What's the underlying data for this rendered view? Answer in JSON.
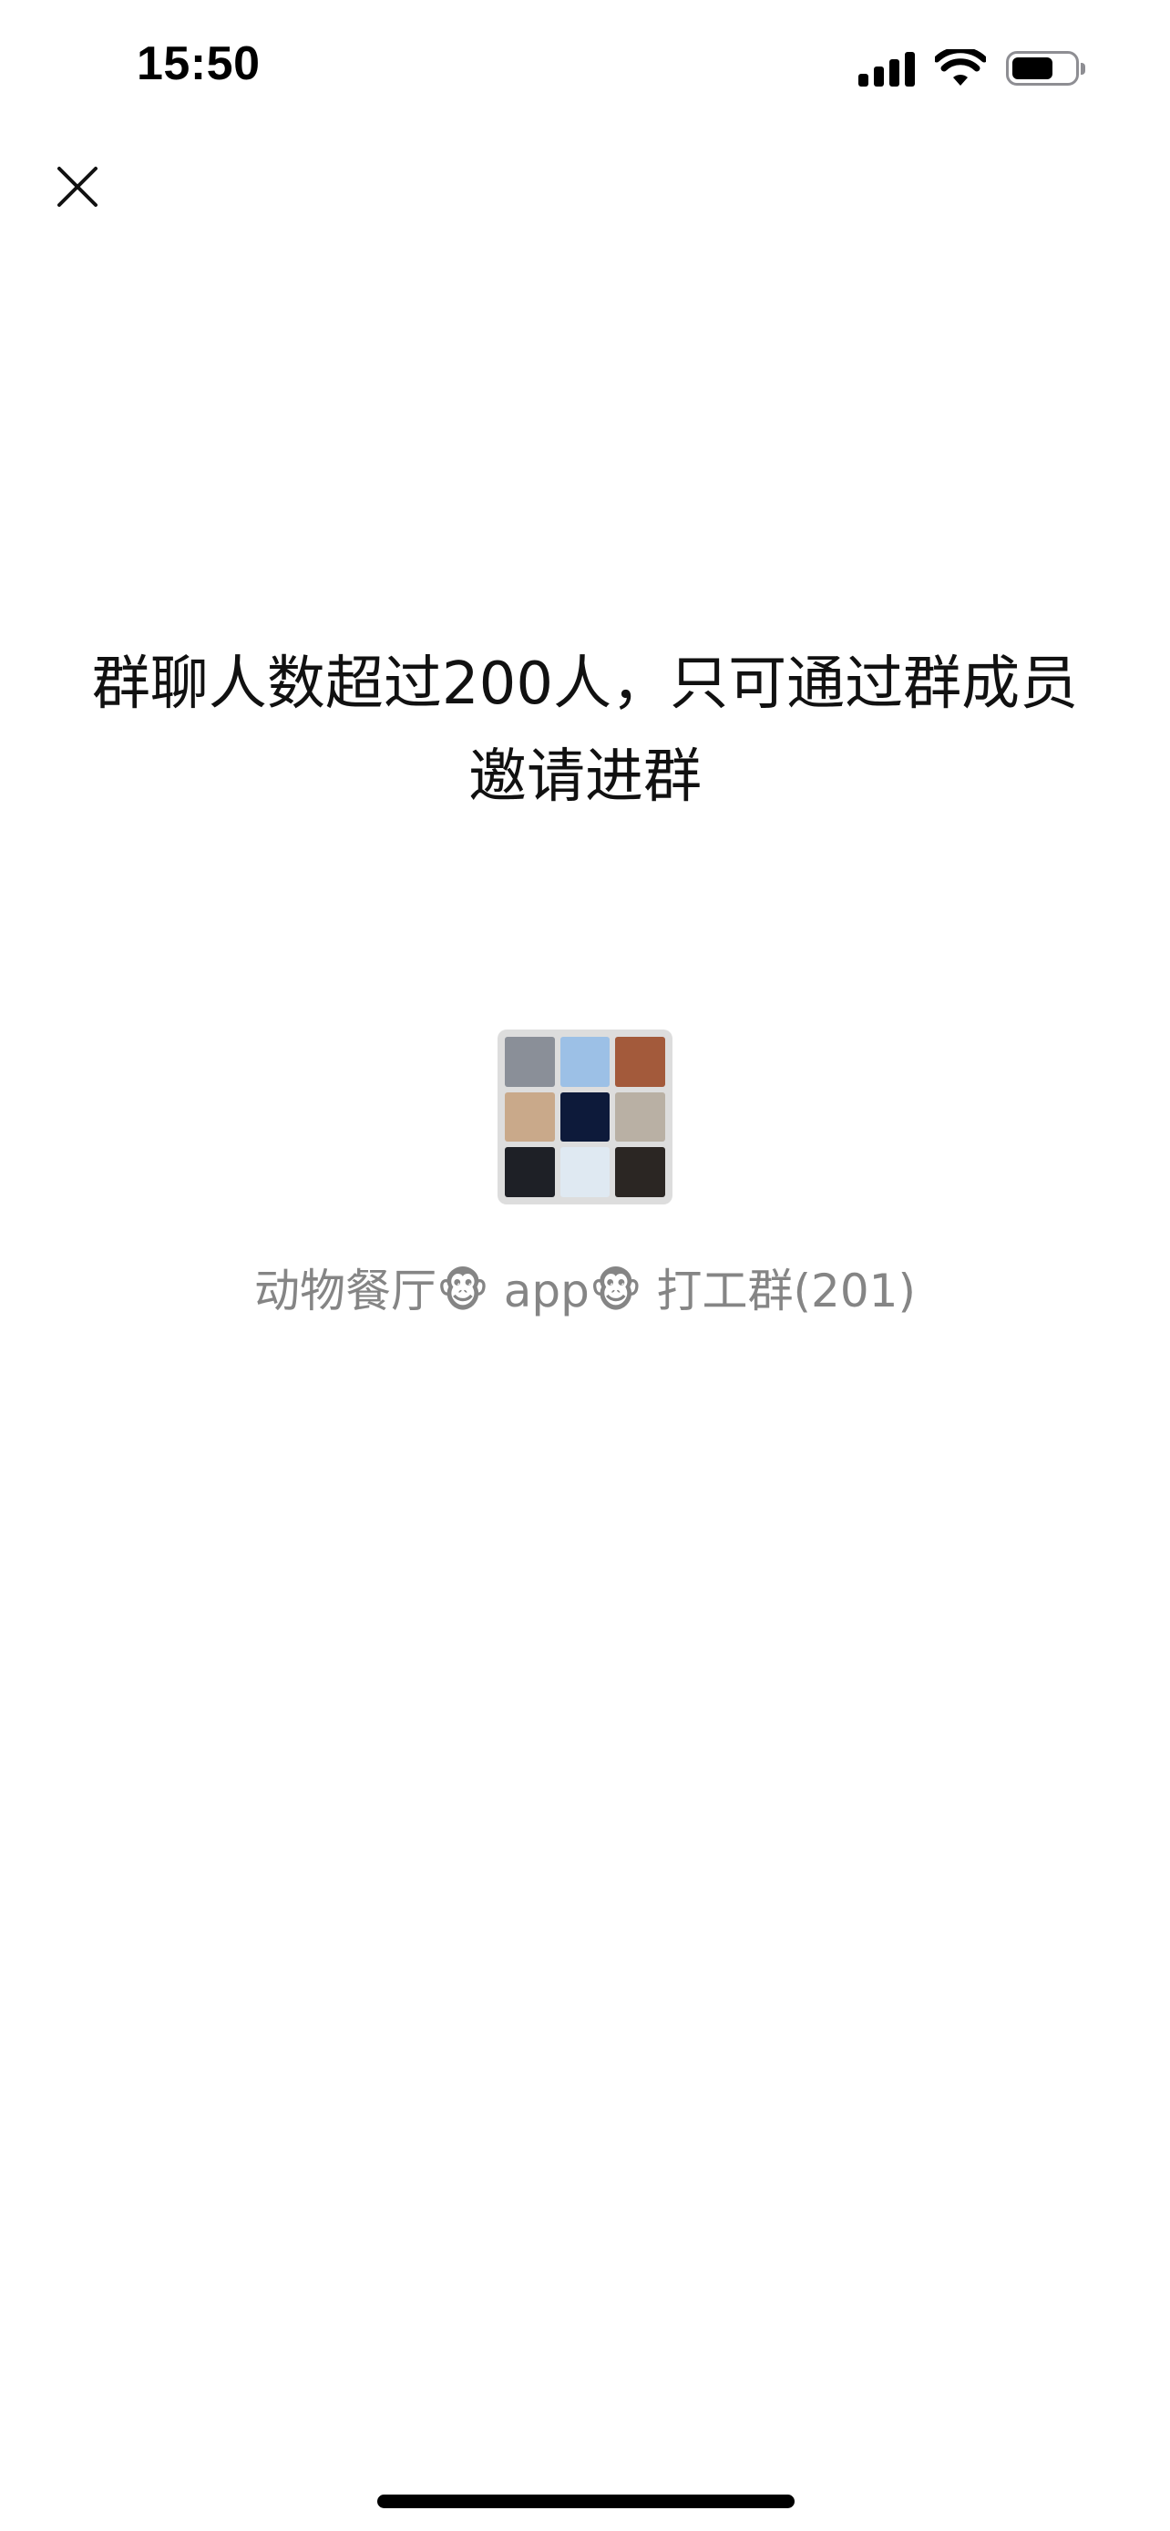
{
  "status_bar": {
    "time": "15:50",
    "signal_icon": "cellular-signal-icon",
    "wifi_icon": "wifi-icon",
    "battery_icon": "battery-icon",
    "battery_level": 0.7
  },
  "header": {
    "close_icon": "close-icon"
  },
  "notice": {
    "text": "群聊人数超过200人，只可通过群成员邀请进群"
  },
  "group": {
    "name": "动物餐厅🐵 app🐵 打工群(201)",
    "avatar_tiles": [
      "#8a8f98",
      "#9cc0e6",
      "#a35a3b",
      "#c9a98a",
      "#0d1a3a",
      "#b9b0a4",
      "#1e2026",
      "#dfe9f2",
      "#2b2623"
    ]
  },
  "colors": {
    "primary_text": "#111111",
    "secondary_text": "#858585",
    "background": "#ffffff"
  }
}
